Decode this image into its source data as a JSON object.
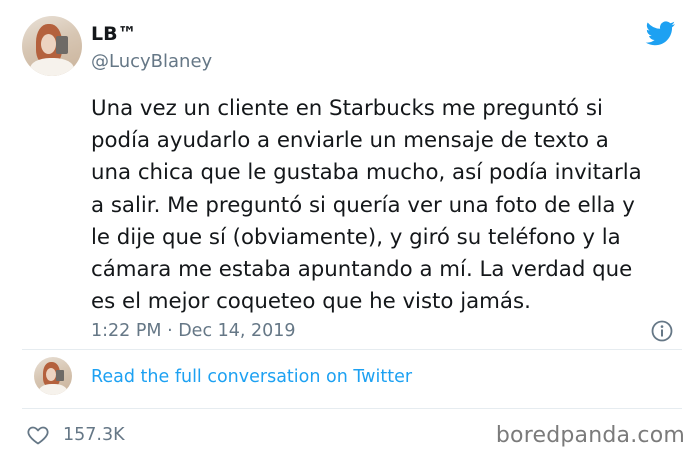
{
  "author": {
    "display_name": "LB™",
    "handle": "@LucyBlaney"
  },
  "tweet": {
    "lines": [
      "Una vez un cliente en Starbucks me preguntó si",
      "podía ayudarlo a enviarle un mensaje de texto a",
      "una chica que le gustaba mucho, así podía invitarla",
      "a salir. Me preguntó si quería ver una foto de ella y",
      "le dije que sí (obviamente), y giró su teléfono y la",
      "cámara me estaba apuntando a mí. La verdad que",
      "es el mejor coqueteo que he visto jamás."
    ],
    "timestamp": "1:22 PM · Dec 14, 2019"
  },
  "conversation": {
    "link_label": "Read the full conversation on Twitter"
  },
  "engagement": {
    "likes": "157.3K"
  },
  "watermark": "boredpanda.com",
  "icons": {
    "brand": "twitter-bird-icon",
    "info": "info-icon",
    "like": "heart-icon"
  },
  "colors": {
    "twitter_blue": "#1da1f2",
    "secondary_text": "#657786",
    "primary_text": "#14171a"
  }
}
